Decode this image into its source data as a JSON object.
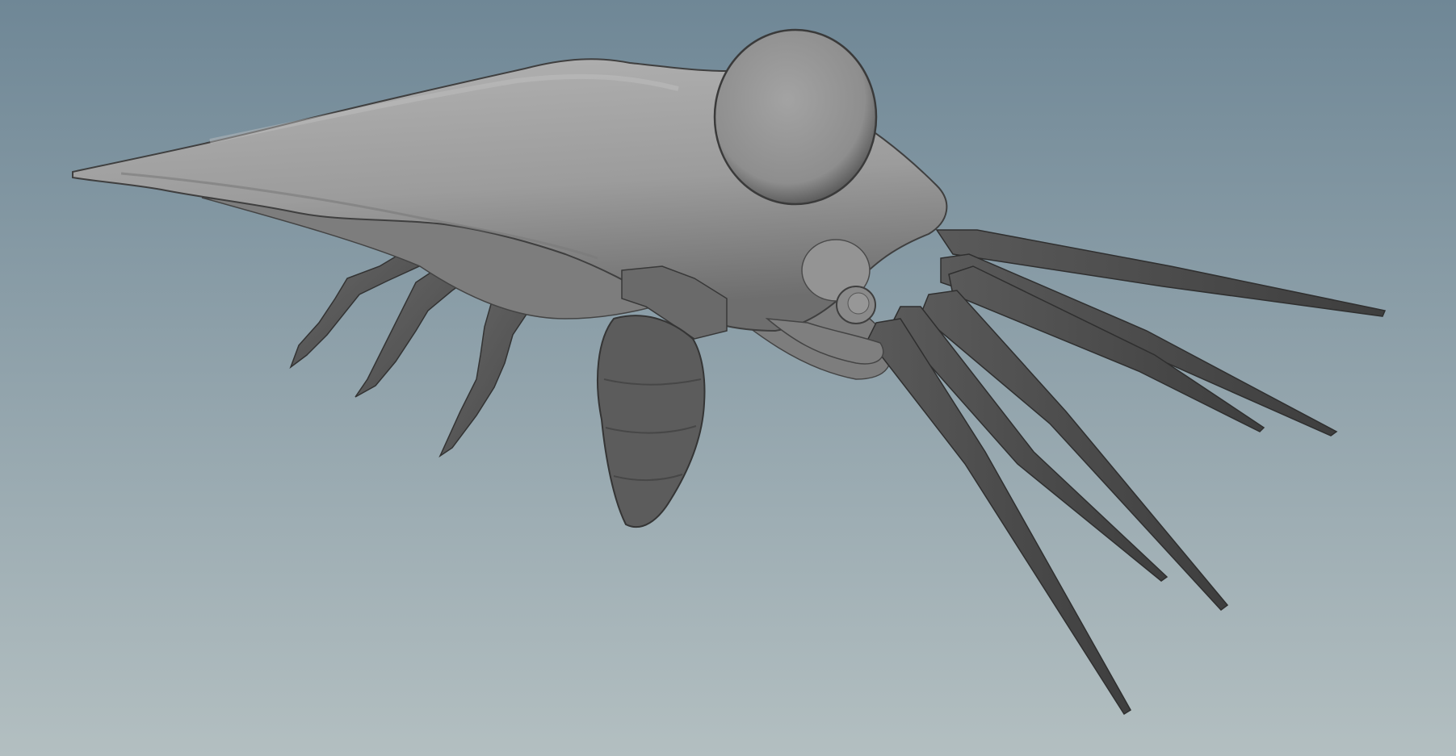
{
  "viewport": {
    "background_top": "#6f8796",
    "background_bottom": "#b3bfc1"
  },
  "model": {
    "body_color": "#9a9a9a",
    "body_highlight": "#b0b0b0",
    "body_shadow": "#5a5a5a",
    "limb_color": "#595959",
    "limb_dark": "#3a3a3a",
    "spine_color": "#4d4d4d"
  }
}
